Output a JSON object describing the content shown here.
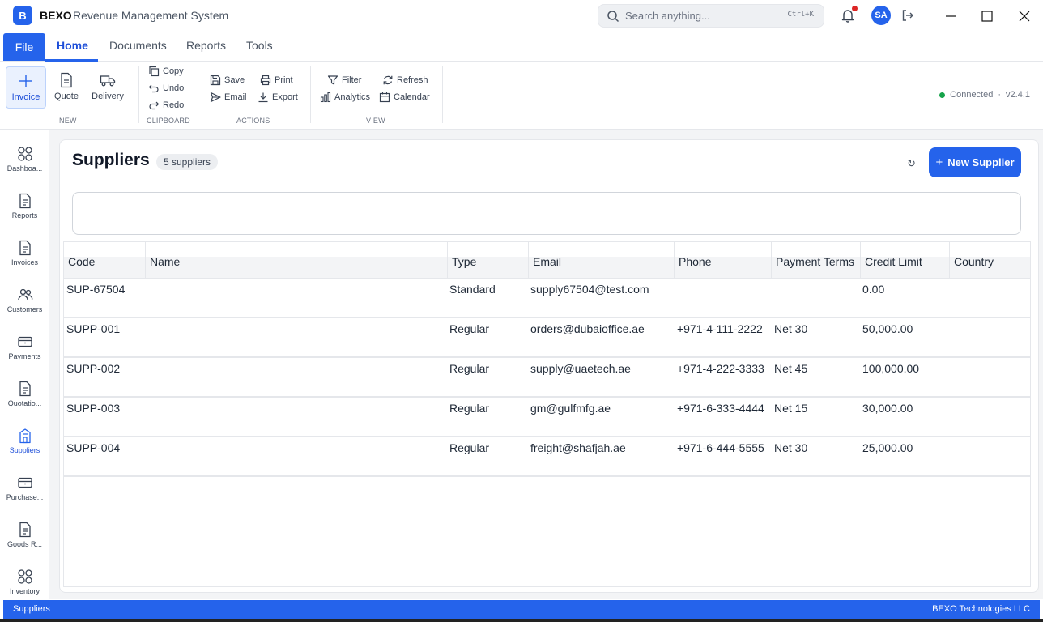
{
  "app": {
    "logo_letter": "B",
    "brand": "BEXO",
    "title": "Revenue Management System",
    "search_placeholder": "Search anything...",
    "search_shortcut": "Ctrl+K",
    "user_initials": "SA"
  },
  "menu": {
    "file": "File",
    "tabs": [
      {
        "label": "Home",
        "active": true
      },
      {
        "label": "Documents",
        "active": false
      },
      {
        "label": "Reports",
        "active": false
      },
      {
        "label": "Tools",
        "active": false
      }
    ]
  },
  "ribbon": {
    "new_group": {
      "label": "NEW",
      "items": [
        "Invoice",
        "Quote",
        "Delivery"
      ]
    },
    "clipboard_group": {
      "label": "CLIPBOARD",
      "items": [
        "Copy",
        "Undo",
        "Redo"
      ]
    },
    "actions_group": {
      "label": "ACTIONS",
      "items": [
        "Save",
        "Print",
        "Email",
        "Export"
      ]
    },
    "view_group": {
      "label": "VIEW",
      "items": [
        "Filter",
        "Refresh",
        "Analytics",
        "Calendar"
      ]
    },
    "status": {
      "text": "Connected",
      "sep": "·",
      "version": "v2.4.1",
      "color": "#16a34a"
    }
  },
  "sidebar": {
    "items": [
      {
        "label": "Dashboa...",
        "icon": "grid-icon"
      },
      {
        "label": "Reports",
        "icon": "document-icon"
      },
      {
        "label": "Invoices",
        "icon": "document-icon"
      },
      {
        "label": "Customers",
        "icon": "users-icon"
      },
      {
        "label": "Payments",
        "icon": "card-icon"
      },
      {
        "label": "Quotatio...",
        "icon": "document-icon"
      },
      {
        "label": "Suppliers",
        "icon": "building-icon",
        "active": true
      },
      {
        "label": "Purchase...",
        "icon": "card-icon"
      },
      {
        "label": "Goods R...",
        "icon": "document-icon"
      },
      {
        "label": "Inventory",
        "icon": "grid-icon"
      }
    ]
  },
  "page": {
    "title": "Suppliers",
    "count_badge": "5 suppliers",
    "reload_glyph": "↻",
    "new_button": "New Supplier",
    "new_button_plus": "+"
  },
  "table": {
    "columns": [
      "Code",
      "Name",
      "Type",
      "Email",
      "Phone",
      "Payment Terms",
      "Credit Limit",
      "Country"
    ],
    "rows": [
      {
        "code": "SUP-67504",
        "name": "",
        "type": "Standard",
        "email": "supply67504@test.com",
        "phone": "",
        "terms": "",
        "credit": "0.00",
        "country": ""
      },
      {
        "code": "SUPP-001",
        "name": "",
        "type": "Regular",
        "email": "orders@dubaioffice.ae",
        "phone": "+971-4-111-2222",
        "terms": "Net 30",
        "credit": "50,000.00",
        "country": ""
      },
      {
        "code": "SUPP-002",
        "name": "",
        "type": "Regular",
        "email": "supply@uaetech.ae",
        "phone": "+971-4-222-3333",
        "terms": "Net 45",
        "credit": "100,000.00",
        "country": ""
      },
      {
        "code": "SUPP-003",
        "name": "",
        "type": "Regular",
        "email": "gm@gulfmfg.ae",
        "phone": "+971-6-333-4444",
        "terms": "Net 15",
        "credit": "30,000.00",
        "country": ""
      },
      {
        "code": "SUPP-004",
        "name": "",
        "type": "Regular",
        "email": "freight@shafjah.ae",
        "phone": "+971-6-444-5555",
        "terms": "Net 30",
        "credit": "25,000.00",
        "country": ""
      }
    ]
  },
  "statusbar": {
    "left": "Suppliers",
    "right": "BEXO Technologies LLC"
  },
  "colors": {
    "accent": "#2563eb",
    "connected": "#16a34a",
    "notification": "#dc2626"
  }
}
